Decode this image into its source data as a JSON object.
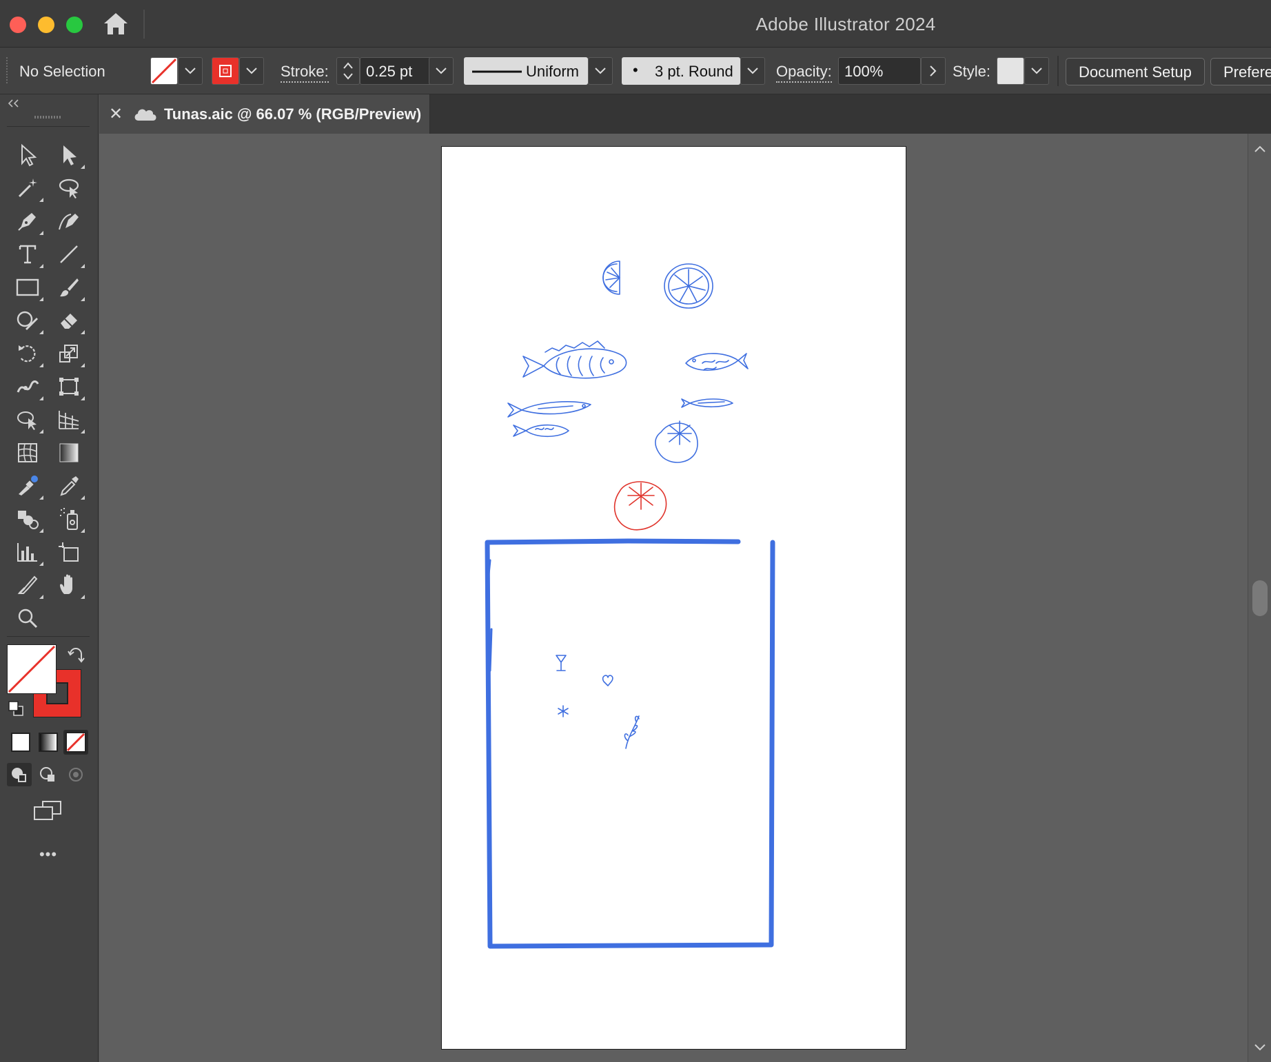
{
  "window": {
    "app_title": "Adobe Illustrator 2024"
  },
  "control_bar": {
    "selection_status": "No Selection",
    "stroke_label": "Stroke:",
    "stroke_weight": "0.25 pt",
    "stroke_profile": "Uniform",
    "brush": "3 pt. Round",
    "opacity_label": "Opacity:",
    "opacity_value": "100%",
    "style_label": "Style:",
    "document_setup": "Document Setup",
    "preferences": "Prefere"
  },
  "document_tab": {
    "title": "Tunas.aic @ 66.07 % (RGB/Preview)"
  },
  "colors": {
    "fill": "none",
    "stroke": "#e8312a",
    "art_blue": "#3f6fe0",
    "art_red": "#e0342c"
  },
  "toolbar": {
    "tools": [
      "selection-tool",
      "direct-selection-tool",
      "magic-wand-tool",
      "lasso-tool",
      "pen-tool",
      "curvature-tool",
      "type-tool",
      "line-segment-tool",
      "rectangle-tool",
      "paintbrush-tool",
      "shaper-tool",
      "eraser-tool",
      "rotate-tool",
      "scale-tool",
      "width-tool",
      "free-transform-tool",
      "shape-builder-tool",
      "perspective-grid-tool",
      "mesh-tool",
      "gradient-tool",
      "blend-tool",
      "eyedropper-tool",
      "symbol-sprayer-tool",
      "live-paint-tool",
      "column-graph-tool",
      "artboard-tool",
      "slice-tool",
      "hand-tool",
      "zoom-tool"
    ],
    "more_label": "•••"
  }
}
